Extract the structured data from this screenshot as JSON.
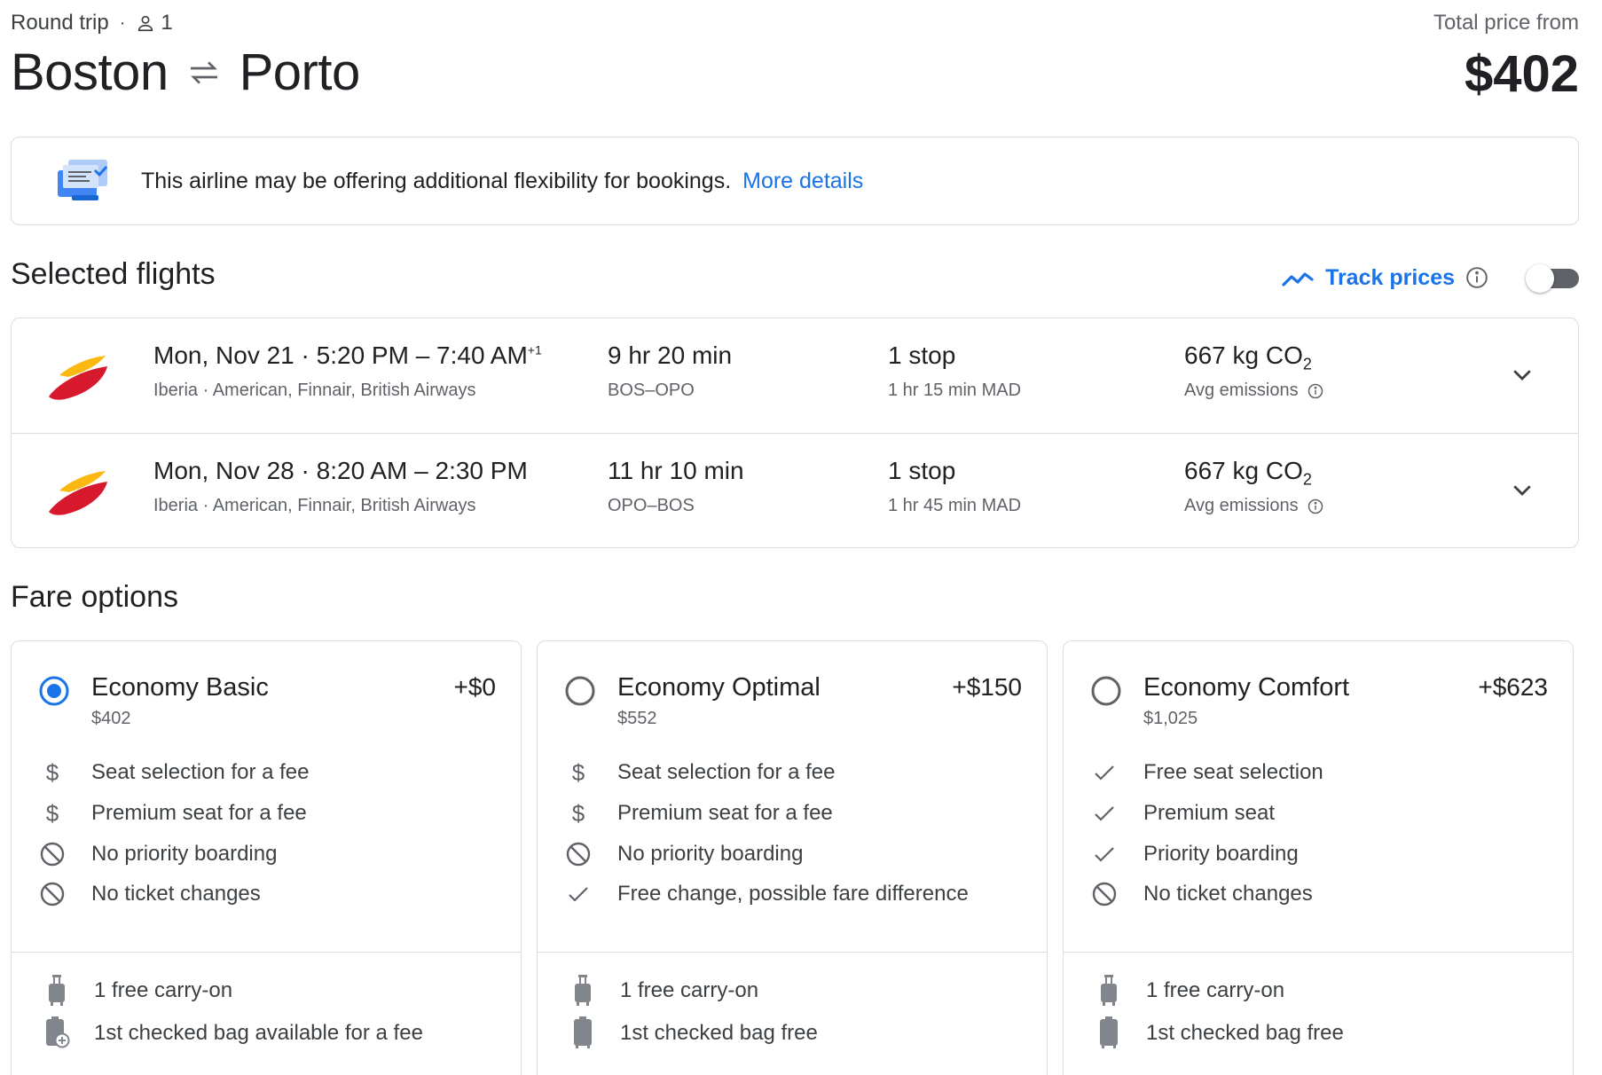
{
  "header": {
    "trip_type": "Round trip",
    "passengers": "1",
    "origin": "Boston",
    "destination": "Porto",
    "total_label": "Total price from",
    "total_price": "$402"
  },
  "banner": {
    "text": "This airline may be offering additional flexibility for bookings.",
    "link": "More details"
  },
  "selected_flights": {
    "title": "Selected flights",
    "track_label": "Track prices",
    "flights": [
      {
        "date": "Mon, Nov 21",
        "times": "5:20 PM – 7:40 AM",
        "day_offset": "+1",
        "airlines": "Iberia · American, Finnair, British Airways",
        "duration": "9 hr 20 min",
        "route": "BOS–OPO",
        "stops": "1 stop",
        "layover": "1 hr 15 min MAD",
        "co2": "667 kg CO",
        "co2_sub": "2",
        "emissions": "Avg emissions"
      },
      {
        "date": "Mon, Nov 28",
        "times": "8:20 AM – 2:30 PM",
        "day_offset": "",
        "airlines": "Iberia · American, Finnair, British Airways",
        "duration": "11 hr 10 min",
        "route": "OPO–BOS",
        "stops": "1 stop",
        "layover": "1 hr 45 min MAD",
        "co2": "667 kg CO",
        "co2_sub": "2",
        "emissions": "Avg emissions"
      }
    ]
  },
  "fare_options": {
    "title": "Fare options",
    "fares": [
      {
        "name": "Economy Basic",
        "delta": "+$0",
        "price": "$402",
        "selected": true,
        "features": [
          {
            "icon": "dollar-icon",
            "text": "Seat selection for a fee"
          },
          {
            "icon": "dollar-icon",
            "text": "Premium seat for a fee"
          },
          {
            "icon": "no-icon",
            "text": "No priority boarding"
          },
          {
            "icon": "no-icon",
            "text": "No ticket changes"
          }
        ],
        "bags": [
          {
            "icon": "carry-on-icon",
            "text": "1 free carry-on"
          },
          {
            "icon": "checked-bag-fee-icon",
            "text": "1st checked bag available for a fee"
          }
        ]
      },
      {
        "name": "Economy Optimal",
        "delta": "+$150",
        "price": "$552",
        "selected": false,
        "features": [
          {
            "icon": "dollar-icon",
            "text": "Seat selection for a fee"
          },
          {
            "icon": "dollar-icon",
            "text": "Premium seat for a fee"
          },
          {
            "icon": "no-icon",
            "text": "No priority boarding"
          },
          {
            "icon": "check-icon",
            "text": "Free change, possible fare difference"
          }
        ],
        "bags": [
          {
            "icon": "carry-on-icon",
            "text": "1 free carry-on"
          },
          {
            "icon": "checked-bag-icon",
            "text": "1st checked bag free"
          }
        ]
      },
      {
        "name": "Economy Comfort",
        "delta": "+$623",
        "price": "$1,025",
        "selected": false,
        "features": [
          {
            "icon": "check-icon",
            "text": "Free seat selection"
          },
          {
            "icon": "check-icon",
            "text": "Premium seat"
          },
          {
            "icon": "check-icon",
            "text": "Priority boarding"
          },
          {
            "icon": "no-icon",
            "text": "No ticket changes"
          }
        ],
        "bags": [
          {
            "icon": "carry-on-icon",
            "text": "1 free carry-on"
          },
          {
            "icon": "checked-bag-icon",
            "text": "1st checked bag free"
          }
        ]
      }
    ]
  },
  "colors": {
    "accent": "#1a73e8",
    "text": "#202124",
    "muted": "#5f6368",
    "border": "#dadce0",
    "iberia_red": "#d7192d",
    "iberia_yellow": "#fbb811"
  }
}
